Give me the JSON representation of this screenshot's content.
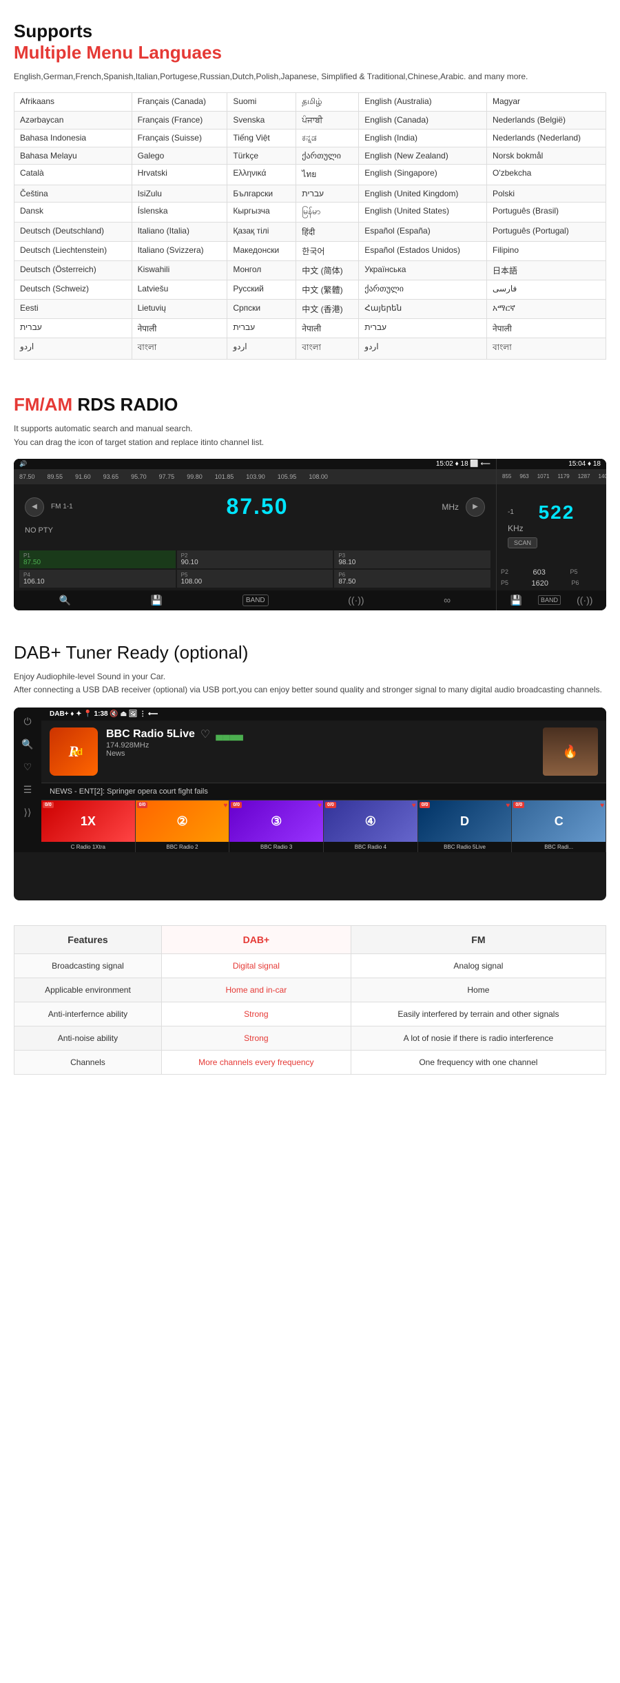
{
  "languages_section": {
    "title_black": "Supports",
    "title_red": "Multiple Menu Languaes",
    "description": "English,German,French,Spanish,Italian,Portugese,Russian,Dutch,Polish,Japanese, Simplified & Traditional,Chinese,Arabic. and many more.",
    "table_rows": [
      [
        "Afrikaans",
        "Français (Canada)",
        "Suomi",
        "தமிழ்",
        "English (Australia)",
        "Magyar"
      ],
      [
        "Azərbaycan",
        "Français (France)",
        "Svenska",
        "ਪੰਜਾਬੀ",
        "English (Canada)",
        "Nederlands (België)"
      ],
      [
        "Bahasa Indonesia",
        "Français (Suisse)",
        "Tiếng Việt",
        "ಕನ್ನಡ",
        "English (India)",
        "Nederlands (Nederland)"
      ],
      [
        "Bahasa Melayu",
        "Galego",
        "Türkçe",
        "ქართული",
        "English (New Zealand)",
        "Norsk bokmål"
      ],
      [
        "Català",
        "Hrvatski",
        "Ελληνικά",
        "ไทย",
        "English (Singapore)",
        "O'zbekcha"
      ],
      [
        "Čeština",
        "IsiZulu",
        "Български",
        "עברית",
        "English (United Kingdom)",
        "Polski"
      ],
      [
        "Dansk",
        "Íslenska",
        "Кыргызча",
        "မြန်မာ",
        "English (United States)",
        "Português (Brasil)"
      ],
      [
        "Deutsch (Deutschland)",
        "Italiano (Italia)",
        "Қазақ тілі",
        "हिंदी",
        "Español (España)",
        "Português (Portugal)"
      ],
      [
        "Deutsch (Liechtenstein)",
        "Italiano (Svizzera)",
        "Македонски",
        "한국어",
        "Español (Estados Unidos)",
        "Filipino"
      ],
      [
        "Deutsch (Österreich)",
        "Kiswahili",
        "Монгол",
        "中文 (简体)",
        "Українська",
        "日本語"
      ],
      [
        "Deutsch (Schweiz)",
        "Latviešu",
        "Русский",
        "中文 (繁體)",
        "ქართული",
        "فارسی"
      ],
      [
        "Eesti",
        "Lietuvių",
        "Српски",
        "中文 (香港)",
        "Հայերեն",
        "አማርኛ"
      ],
      [
        "עברית",
        "नेपाली",
        "עברית",
        "नेपाली",
        "עברית",
        "नेपाली"
      ],
      [
        "اردو",
        "বাংলা",
        "اردو",
        "বাংলা",
        "اردو",
        "বাংলা"
      ]
    ]
  },
  "radio_section": {
    "title_red": "FM/AM",
    "title_black": " RDS RADIO",
    "description_line1": "It supports automatic search and manual search.",
    "description_line2": "You can drag the icon of target station and replace itinto channel list.",
    "fm_display": {
      "statusbar": "15:02  ♦  18  ⬜  ⟵",
      "freq_label": "FM 1-1",
      "freq_value": "87.50",
      "unit": "MHz",
      "pty": "NO PTY",
      "presets": [
        {
          "num": "P1",
          "freq": "87.50",
          "active": true
        },
        {
          "num": "P2",
          "freq": "90.10",
          "active": false
        },
        {
          "num": "P3",
          "freq": "98.10",
          "active": false
        },
        {
          "num": "P4",
          "freq": "106.10",
          "active": false
        },
        {
          "num": "P5",
          "freq": "108.00",
          "active": false
        },
        {
          "num": "P6",
          "freq": "87.50",
          "active": false
        }
      ]
    },
    "am_display": {
      "statusbar": "15:04  ♦  18",
      "freq_value": "522",
      "unit": "KHz",
      "scan_label": "SCAN",
      "presets": [
        {
          "num": "P2",
          "freq": "603"
        },
        {
          "num": "P5",
          "freq": "1620"
        }
      ]
    }
  },
  "dab_section": {
    "title_red": "DAB+ Tuner Ready",
    "title_black": " (optional)",
    "description_line1": "Enjoy Audiophile-level Sound in your Car.",
    "description_line2": "After connecting a USB DAB receiver (optional) via USB port,you can enjoy better sound quality and stronger signal to many digital audio broadcasting channels.",
    "screenshot": {
      "statusbar": "DAB+   ♦  ✦  📍  1:38  🔇  ⏏  🖼  ⋮  ⟵",
      "station_name": "BBC Radio 5Live",
      "frequency": "174.928MHz",
      "type": "News",
      "news_ticker": "NEWS - ENT[2]: Springer opera court fight fails",
      "channels": [
        {
          "name": "C Radio 1Xtra",
          "logo": "1X",
          "badge": "0/0",
          "colors": [
            "#cc0000",
            "#ff4444"
          ]
        },
        {
          "name": "BBC Radio 2",
          "logo": "2",
          "badge": "0/0",
          "colors": [
            "#ff6600",
            "#ff9900"
          ]
        },
        {
          "name": "BBC Radio 3",
          "logo": "3",
          "badge": "0/0",
          "colors": [
            "#6600cc",
            "#9933ff"
          ]
        },
        {
          "name": "BBC Radio 4",
          "logo": "4",
          "badge": "0/0",
          "colors": [
            "#333399",
            "#6666cc"
          ]
        },
        {
          "name": "BBC Radio 5Live",
          "logo": "D",
          "badge": "0/0",
          "colors": [
            "#003366",
            "#336699"
          ]
        },
        {
          "name": "BBC Radi...",
          "logo": "C",
          "badge": "0/0",
          "colors": [
            "#336699",
            "#6699cc"
          ]
        }
      ]
    }
  },
  "comparison_section": {
    "headers": [
      "Features",
      "DAB+",
      "FM"
    ],
    "rows": [
      [
        "Broadcasting signal",
        "Digital signal",
        "Analog signal"
      ],
      [
        "Applicable environment",
        "Home and in-car",
        "Home"
      ],
      [
        "Anti-interfernce ability",
        "Strong",
        "Easily interfered by terrain and other signals"
      ],
      [
        "Anti-noise ability",
        "Strong",
        "A lot of nosie if there is radio interference"
      ],
      [
        "Channels",
        "More channels every frequency",
        "One frequency with one channel"
      ]
    ]
  }
}
